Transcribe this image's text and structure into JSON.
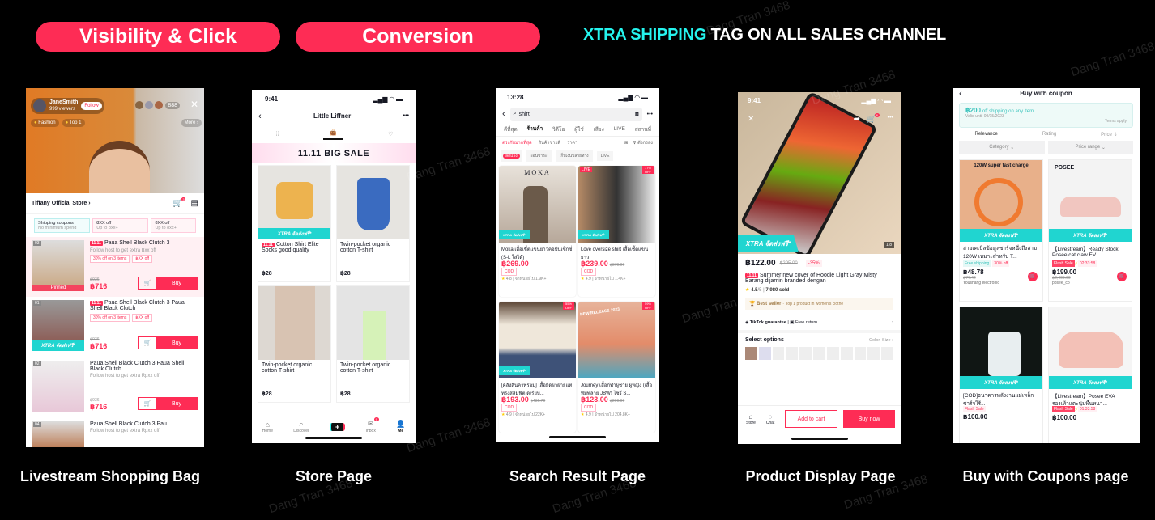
{
  "header": {
    "pill_1": "Visibility & Click",
    "pill_2": "Conversion",
    "headline_highlight": "XTRA SHIPPING",
    "headline_rest": " TAG ON ALL SALES CHANNEL"
  },
  "colors": {
    "accent": "#fe2c55",
    "xtra": "#20d5d0",
    "highlight": "#25f4ee",
    "background": "#000000"
  },
  "watermark": "Dang Tran 3468",
  "captions": [
    "Livestream Shopping Bag",
    "Store Page",
    "Search Result Page",
    "Product Display Page",
    "Buy with Coupons page"
  ],
  "livestream": {
    "host": "JaneSmith",
    "viewers": "999 viewers",
    "follow": "Follow",
    "viewer_count": "888",
    "tags": [
      "Fashion",
      "Top 1"
    ],
    "more": "More",
    "store": "Tiffany Official Store",
    "cart_badge": "3",
    "coupons": [
      {
        "title": "Shipping coupons",
        "sub": "No minimum spend"
      },
      {
        "title": "8XX off",
        "sub": "Up to 8xx+"
      },
      {
        "title": "8XX off",
        "sub": "Up to 8xx+"
      }
    ],
    "items": [
      {
        "num": "03",
        "badge": "11.11",
        "title": "Paua Shell Black Clutch 3",
        "sub": "Follow host to get extra ฿xx off",
        "tag1": "30% off on 3 items",
        "tag2": "฿XX off",
        "old": "฿936",
        "price": "฿716",
        "buy": "Buy",
        "overlay": "Pinned"
      },
      {
        "num": "01",
        "badge": "11.11",
        "title": "Paua Shell Black Clutch 3 Paua Shell Black Clutch",
        "tag1": "30% off on 3 items",
        "tag2": "฿XX off",
        "old": "฿936",
        "price": "฿716",
        "buy": "Buy",
        "xtra": "XTRA จัดส่งฟรี*"
      },
      {
        "num": "02",
        "title": "Paua Shell Black Clutch 3 Paua Shell Black Clutch",
        "sub": "Follow host to get extra Rpxx off",
        "old": "฿936",
        "price": "฿716",
        "buy": "Buy"
      },
      {
        "num": "04",
        "title": "Paua Shell Black Clutch 3 Pau",
        "sub": "Follow host to get extra Rpxx off"
      }
    ]
  },
  "store": {
    "time": "9:41",
    "title": "Little Liffner",
    "banner": "11.11 BIG SALE",
    "products": [
      {
        "badge": "11.11",
        "name": "Cotton Shirt Elite Socks good quality",
        "price": "฿28",
        "xtra": "XTRA จัดส่งฟรี*"
      },
      {
        "name": "Twin-pocket organic cotton T-shirt",
        "price": "฿28"
      },
      {
        "name": "Twin-pocket organic cotton T-shirt",
        "price": "฿28"
      },
      {
        "name": "Twin-pocket organic cotton T-shirt",
        "price": "฿28"
      }
    ],
    "nav": [
      "Home",
      "Discover",
      "+",
      "Inbox",
      "Me"
    ],
    "inbox_badge": "9"
  },
  "search": {
    "time": "13:28",
    "query": "shirt",
    "tabs": [
      "ดีที่สุด",
      "ร้านค้า",
      "วิดีโอ",
      "ผู้ใช้",
      "เสียง",
      "LIVE",
      "สถานที่"
    ],
    "sorts": [
      "ตรงกับมากที่สุด",
      "สินค้าขายดี",
      "ราคา"
    ],
    "filter": "ตัวกรอง",
    "chips": [
      "ลดแรง",
      "ผ่อนชำระ",
      "เก็บเงินปลายทาง",
      "LIVE"
    ],
    "products": [
      {
        "title": "Moka เสื้อเชิ้ตแขนยาวคอปีนเซ็กซี่ (S-L ใส่ได้)",
        "price": "฿269.00",
        "rating": "4.8",
        "sold": "จำหน่ายไป 1.9K+",
        "brand": "MOKA",
        "xtra": "XTRA จัดส่งฟรี*",
        "cod": "COD"
      },
      {
        "title": "Love oversize shirt เสื้อเชิ้ตแขนยาว",
        "price": "฿239.00",
        "old": "฿379.00",
        "rating": "4.9",
        "sold": "จำหน่ายไป 1.4K+",
        "live": "LIVE",
        "off": "17% OFF",
        "xtra": "XTRA จัดส่งฟรี*",
        "cod": "COD"
      },
      {
        "title": "[คลังสินค้าพร้อม] เสื้อยืดผ้าฝ้ายแท้ ทรงสลิมฟิต ดูเรียบ...",
        "price": "฿193.00",
        "old": "฿431.70",
        "rating": "4.9",
        "sold": "จำหน่ายไป 22K+",
        "off": "55% OFF",
        "xtra": "XTRA จัดส่งฟรี*",
        "cod": "COD"
      },
      {
        "title": "Journey เสื้อกีฬาผู้ชาย ผู้หญิง (เสื้อพิมพ์ลาย JBW) ไซร์ S...",
        "price": "฿123.00",
        "old": "฿299.00",
        "rating": "4.9",
        "sold": "จำหน่ายไป 204.8K+",
        "off": "59% OFF",
        "cod": "COD",
        "release": "NEW RELEASE 2023"
      }
    ]
  },
  "product": {
    "time": "9:41",
    "cart_badge": "6",
    "xtra": "XTRA จัดส่งฟรี*",
    "counter": "1/8",
    "price": "฿122.00",
    "old": "฿295.00",
    "discount": "-35%",
    "badge": "11.11",
    "title": "Summer new cover of Hoodie Light Gray Misty Barang dijamin branded dengan",
    "rating": "4.5",
    "rating_max": "/5",
    "sold": "7,980 sold",
    "best_seller": "Best seller",
    "best_seller_note": "Top 1 product in women's clothe",
    "guarantee": "TikTok guarantee",
    "free_return": "Free return",
    "select_options": "Select options",
    "option_types": "Color, Size",
    "store": "Store",
    "chat": "Chat",
    "add_to_cart": "Add to cart",
    "buy_now": "Buy now"
  },
  "coupon": {
    "title": "Buy with coupon",
    "amount": "฿200",
    "offer": "off shipping on any item",
    "valid": "Valid until 09/15/2023",
    "terms": "Terms apply",
    "sorts": [
      "Relevance",
      "Rating",
      "Price"
    ],
    "filters": [
      "Category",
      "Price range"
    ],
    "products": [
      {
        "image_text": "120W super fast charge",
        "title": "สายเคเบิลข้อมูลชาร์จหนึ่งถึงสาม 120W เหมาะสำหรับ T...",
        "tag1": "Free shipping",
        "tag2": "30% off",
        "price": "฿48.78",
        "old": "฿77.42",
        "seller": "Youshang electronic",
        "xtra": "XTRA จัดส่งฟรี*"
      },
      {
        "image_text": "POSEE",
        "title": "【Livestream】Ready Stock Posee cat claw EV...",
        "tag1": "Flash Sale",
        "tag2": "02:33:58",
        "price": "฿199.00",
        "old": "฿2,400.00",
        "seller": "posee_co",
        "xtra": "XTRA จัดส่งฟรี*"
      },
      {
        "title": "[COD]ธนาคารพลังงานแม่เหล็กชาร์จไร้...",
        "tag1": "Flash Sale",
        "price": "฿100.00",
        "xtra": "XTRA จัดส่งฟรี*"
      },
      {
        "title": "【Livestream】Posee EVA รองเท้าแตะนุ่มพื้นหนา...",
        "tag1": "Flash Sale",
        "tag2": "01:33:58",
        "price": "฿100.00",
        "xtra": "XTRA จัดส่งฟรี*"
      }
    ]
  }
}
